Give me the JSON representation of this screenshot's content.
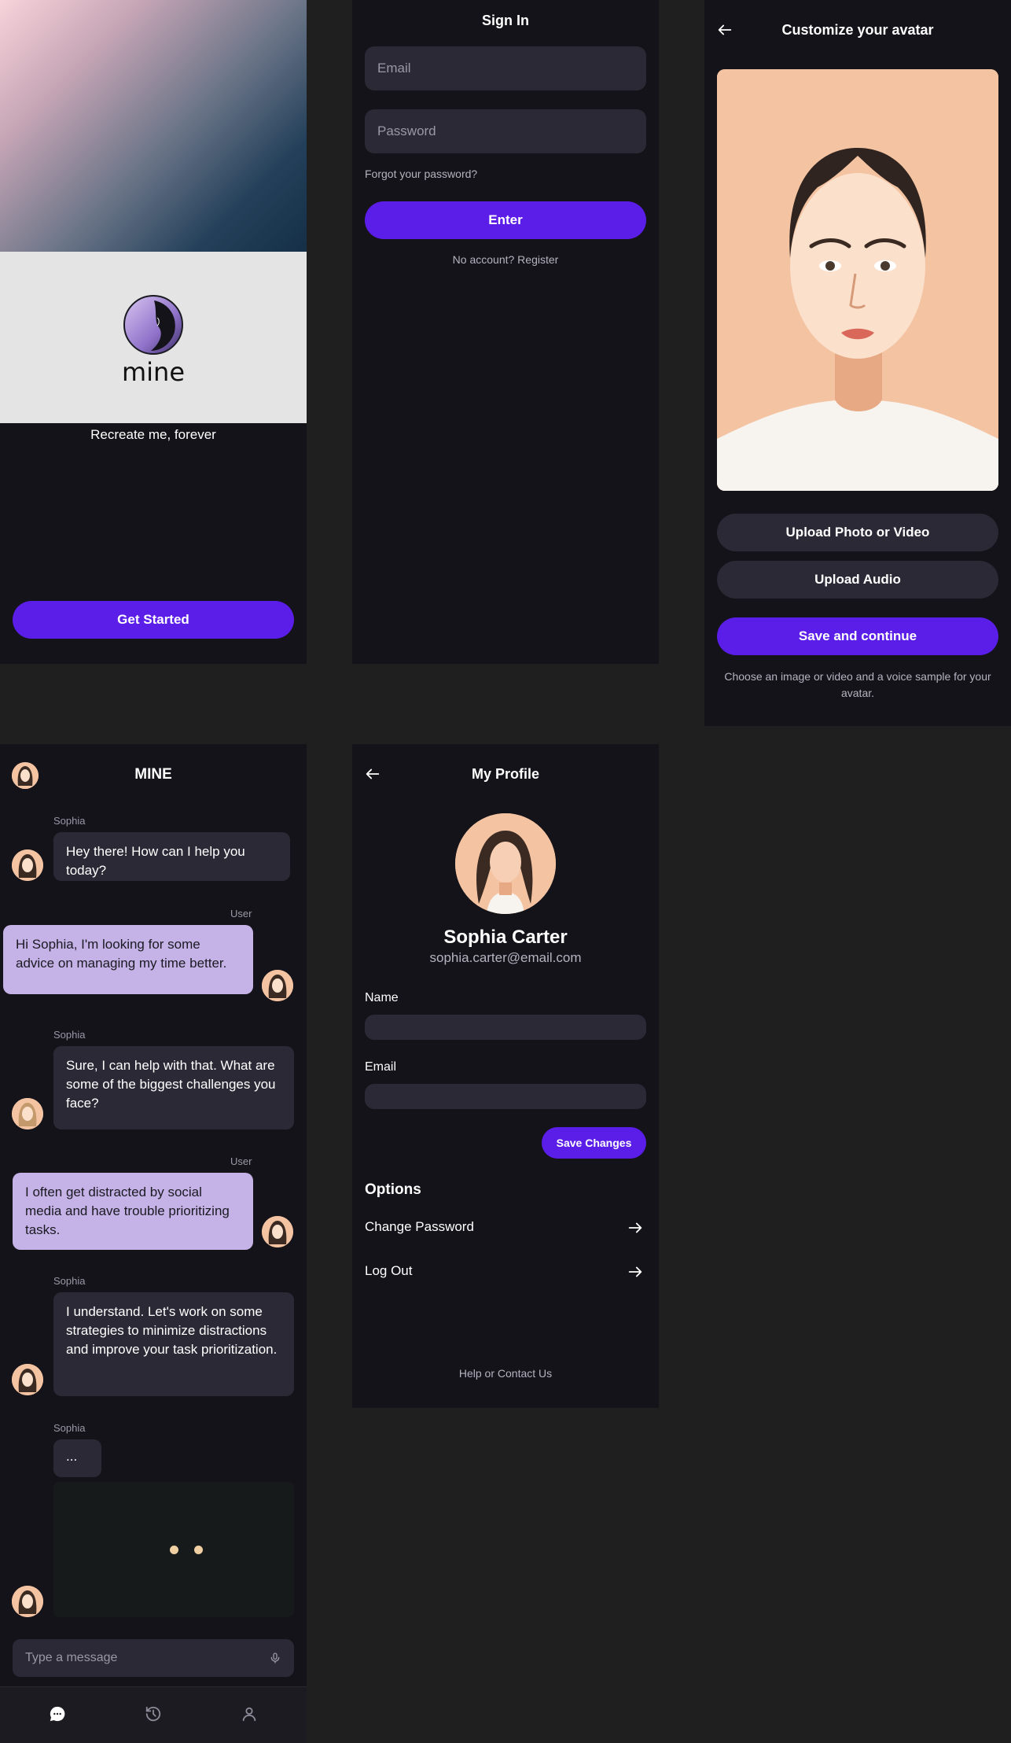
{
  "welcome": {
    "logo_text": "mine",
    "tagline": "Recreate me, forever",
    "cta": "Get Started"
  },
  "signin": {
    "title": "Sign In",
    "email_placeholder": "Email",
    "password_placeholder": "Password",
    "forgot": "Forgot your password?",
    "enter": "Enter",
    "register": "No account? Register"
  },
  "customize": {
    "title": "Customize your avatar",
    "upload_photo": "Upload Photo or Video",
    "upload_audio": "Upload Audio",
    "save": "Save and continue",
    "hint": "Choose an image or video and a voice sample for your avatar."
  },
  "chat": {
    "title": "MINE",
    "messages": [
      {
        "sender": "Sophia",
        "text": "Hey there! How can I help you today?"
      },
      {
        "sender": "User",
        "text": "Hi Sophia, I'm looking for some advice on managing my time better."
      },
      {
        "sender": "Sophia",
        "text": "Sure, I can help with that. What are some of the biggest challenges you face?"
      },
      {
        "sender": "User",
        "text": "I often get distracted by social media and have trouble prioritizing tasks."
      },
      {
        "sender": "Sophia",
        "text": "I understand. Let's work on some strategies to minimize distractions and improve your task prioritization."
      },
      {
        "sender": "Sophia",
        "text": "..."
      }
    ],
    "input_placeholder": "Type  a message"
  },
  "profile": {
    "title": "My Profile",
    "name": "Sophia Carter",
    "email": "sophia.carter@email.com",
    "name_label": "Name",
    "email_label": "Email",
    "save": "Save Changes",
    "options_title": "Options",
    "change_password": "Change Password",
    "logout": "Log Out",
    "help": "Help or Contact Us"
  },
  "colors": {
    "accent": "#5b1ee8",
    "background": "#141319",
    "surface": "#2b2935",
    "user_bubble": "#c5b2e6"
  }
}
